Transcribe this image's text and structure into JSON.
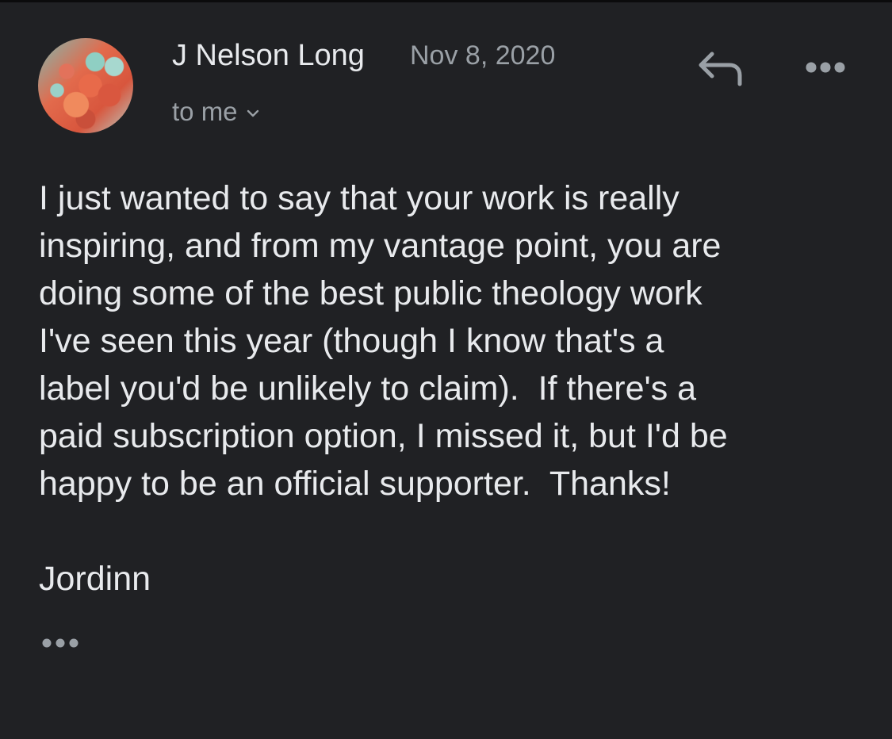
{
  "message": {
    "sender_name": "J Nelson Long",
    "date": "Nov 8, 2020",
    "recipient_label": "to me",
    "body_lines": [
      "I just wanted to say that your work is really",
      "inspiring, and from my vantage point, you are",
      "doing some of the best public theology work",
      "I've seen this year (though I know that's a",
      "label you'd be unlikely to claim).  If there's a",
      "paid subscription option, I missed it, but I'd be",
      "happy to be an official supporter.  Thanks!"
    ],
    "signature": "Jordinn"
  },
  "icons": {
    "reply": "reply-arrow-icon",
    "more": "more-horizontal-icon",
    "expand_recipients": "chevron-down-icon",
    "show_trimmed": "more-horizontal-icon"
  },
  "colors": {
    "background": "#202124",
    "primary_text": "#e8eaed",
    "secondary_text": "#9aa0a6"
  }
}
